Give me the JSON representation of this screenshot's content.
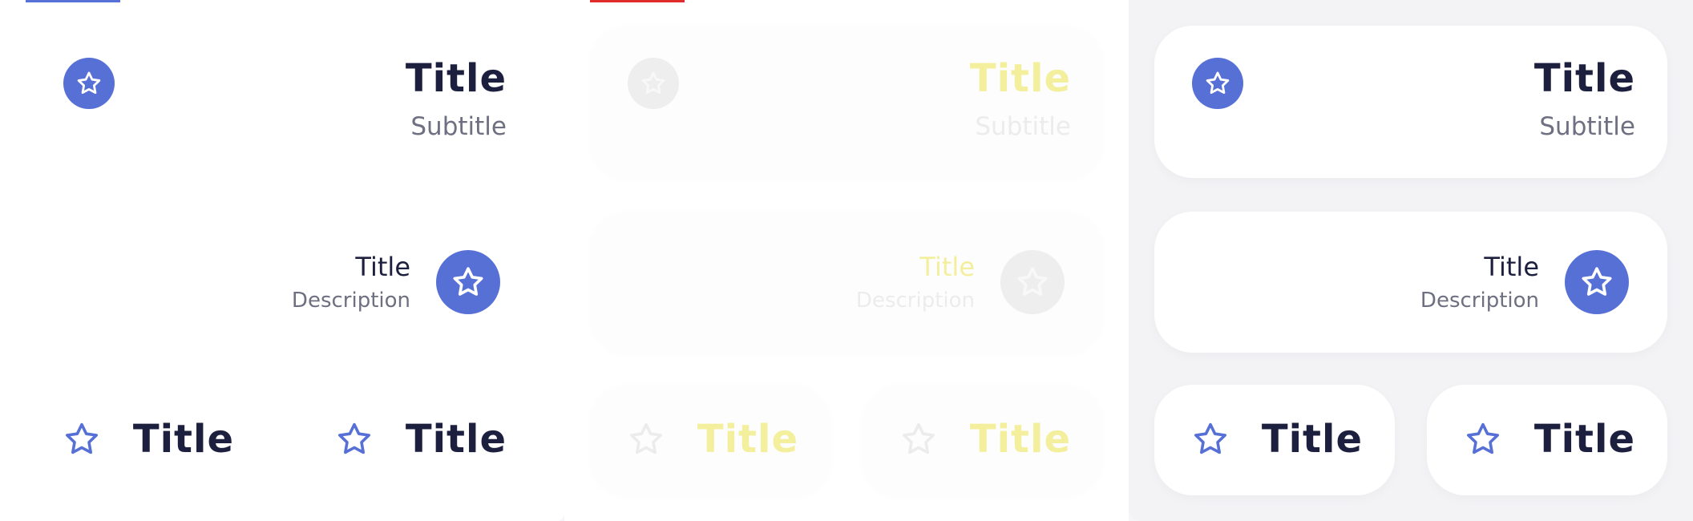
{
  "panels": [
    {
      "card_a": {
        "title": "Title",
        "subtitle": "Subtitle",
        "icon": "star-icon"
      },
      "card_b": {
        "title": "Title",
        "description": "Description",
        "icon": "star-icon"
      },
      "card_c1": {
        "title": "Title",
        "icon": "star-icon"
      },
      "card_c2": {
        "title": "Title",
        "icon": "star-icon"
      }
    },
    {
      "card_a": {
        "title": "Title",
        "subtitle": "Subtitle",
        "icon": "star-icon"
      },
      "card_b": {
        "title": "Title",
        "description": "Description",
        "icon": "star-icon"
      },
      "card_c1": {
        "title": "Title",
        "icon": "star-icon"
      },
      "card_c2": {
        "title": "Title",
        "icon": "star-icon"
      }
    },
    {
      "card_a": {
        "title": "Title",
        "subtitle": "Subtitle",
        "icon": "star-icon"
      },
      "card_b": {
        "title": "Title",
        "description": "Description",
        "icon": "star-icon"
      },
      "card_c1": {
        "title": "Title",
        "icon": "star-icon"
      },
      "card_c2": {
        "title": "Title",
        "icon": "star-icon"
      }
    }
  ],
  "colors": {
    "accent": "#5670d6",
    "title_text": "#1d1f3e",
    "secondary_text": "#6e7082",
    "tab_indicator_1": "#5670d6",
    "tab_indicator_2": "#e02b2b"
  }
}
